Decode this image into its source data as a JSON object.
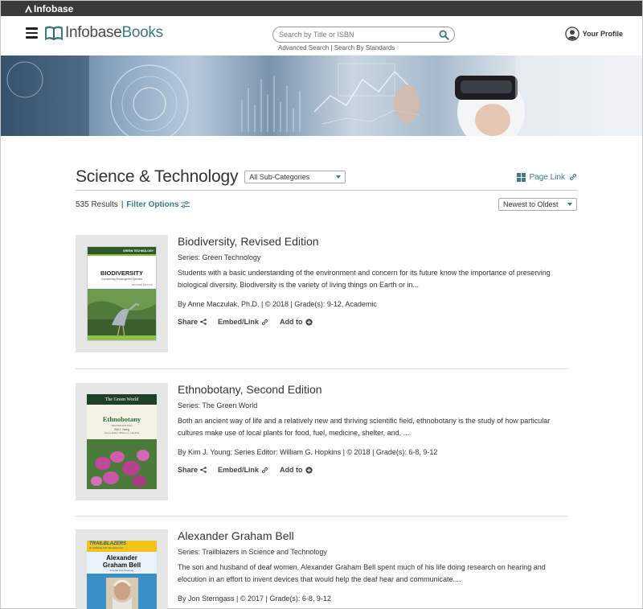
{
  "topbar": {
    "brand": "Infobase"
  },
  "header": {
    "logo_prefix": "Infobase",
    "logo_suffix": "Books",
    "search_placeholder": "Search by Title or ISBN",
    "advanced_search": "Advanced Search",
    "search_by_standards": "Search By Standards",
    "link_separator": "|",
    "profile_label": "Your Profile"
  },
  "page": {
    "title": "Science & Technology",
    "subcategory_selected": "All Sub-Categories",
    "page_link": "Page Link",
    "results_count": "535 Results",
    "separator": "|",
    "filter_options": "Filter Options",
    "sort_selected": "Newest to Oldest"
  },
  "actions": {
    "share": "Share",
    "embed": "Embed/Link",
    "add": "Add to"
  },
  "books": [
    {
      "title": "Biodiversity, Revised Edition",
      "series": "Series: Green Technology",
      "description": "Students with a basic understanding of the environment and concern for its future know the importance of preserving biological diversity. Biodiversity is the variety of living things on Earth or in...",
      "byline": "By Anne Maczulak, Ph.D. | © 2018 | Grade(s): 9-12, Academic",
      "cover": {
        "banner_text": "GREEN TECHNOLOGY",
        "title": "BIODIVERSITY",
        "subtitle": "Conserving Endangered Species",
        "edition": "REVISED EDITION",
        "author": "ANNE MACZULAK, PH.D.",
        "accent": "#8fc14a"
      }
    },
    {
      "title": "Ethnobotany, Second Edition",
      "series": "Series: The Green World",
      "description": "Both an ancient way of life and a relatively new and thriving scientific field, ethnobotany is the study of how particular cultures make use of local plants for food, fuel, medicine, shelter, and, ...",
      "byline": "By Kim J. Young; Series Editor: William G. Hopkins | © 2018 | Grade(s): 6-8, 9-12",
      "cover": {
        "banner_text": "The Green World",
        "title": "Ethnobotany",
        "edition": "SECOND EDITION",
        "author": "Kim J. Young",
        "editor": "Series Editor William G. Hopkins",
        "accent": "#2f6b3a"
      }
    },
    {
      "title": "Alexander Graham Bell",
      "series": "Series: Trailblazers in Science and Technology",
      "description": "The son and husband of deaf women, Alexander Graham Bell spent much of his life doing research on hearing and elocution in an effort to invent devices that would help the deaf hear and communicate....",
      "byline": "By Jon Sterngass | © 2017 | Grade(s): 6-8, 9-12",
      "cover": {
        "banner_text": "TRAILBLAZERS",
        "banner_sub": "IN SCIENCE AND TECHNOLOGY",
        "title_line1": "Alexander",
        "title_line2": "Graham Bell",
        "subtitle": "Inventor and Visionary",
        "accent": "#f0c419"
      }
    }
  ]
}
